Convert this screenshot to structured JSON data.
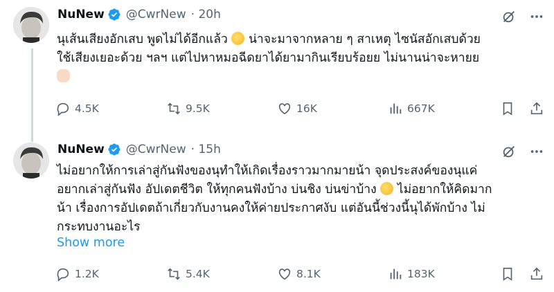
{
  "tweets": [
    {
      "name": "NuNew",
      "handle": "@CwrNew",
      "time": "· 20h",
      "text_line1": "นุเส้นเสียงอักเสบ พูดไม่ได้อีกแล้ว ",
      "text_line1b": " น่าจะมาจากหลาย ๆ สาเหตุ ไซนัสอักเสบด้วย",
      "text_line2": "ใช้เสียงเยอะด้วย ฯลฯ แต่ไปหาหมอฉีดยาได้ยามากินเรียบร้อยย ไม่นานน่าจะหายย",
      "emoji1": "sweat-smile-emoji",
      "emoji2": "flexed-biceps-emoji",
      "replies": "4.5K",
      "retweets": "9.5K",
      "likes": "16K",
      "views": "667K"
    },
    {
      "name": "NuNew",
      "handle": "@CwrNew",
      "time": "· 15h",
      "text_line1": "ไม่อยากให้การเล่าสู่กันฟังของนุทำให้เกิดเรื่องราวมากมายน้า จุดประสงค์ของนุแค่",
      "text_line2": "อยากเล่าสู่กันฟัง อัปเดตชีวิต ให้ทุกคนฟังบ้าง บ่นชิง บ่นข่าบ้าง ",
      "text_line2b": " ไม่อยากให้คิดมาก",
      "text_line3": "น้า เรื่องการอัปเดตถ้าเกี่ยวกับงานคงให้ค่ายประกาศงับ แต่อันนี้ช่วงนี้นุได้พักบ้าง ไม่",
      "text_line4": "กระทบงานอะไร",
      "emoji": "face-with-tears-of-joy-emoji",
      "show_more": "Show more",
      "replies": "1.2K",
      "retweets": "5.4K",
      "likes": "8.1K",
      "views": "183K"
    }
  ],
  "colors": {
    "verified": "#1d9bf0",
    "link": "#1d9bf0",
    "muted": "#536471",
    "thread_line": "#cfd9de"
  }
}
